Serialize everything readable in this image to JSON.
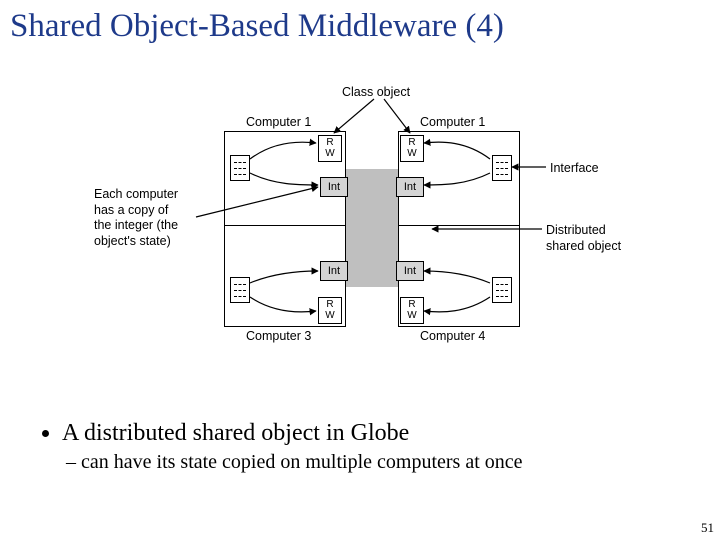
{
  "title": "Shared Object-Based Middleware (4)",
  "labels": {
    "class_object": "Class object",
    "comp1a": "Computer 1",
    "comp1b": "Computer 1",
    "comp3": "Computer 3",
    "comp4": "Computer 4",
    "interface": "Interface",
    "dist_shared": "Distributed shared object",
    "each_copy": "Each computer\nhas a copy of\nthe integer (the\nobject's state)"
  },
  "box_text": {
    "int": "Int",
    "rw": "R\nW"
  },
  "bullets": {
    "main": "A distributed shared object in Globe",
    "sub": "can have its state copied on multiple computers at once"
  },
  "page": "51"
}
